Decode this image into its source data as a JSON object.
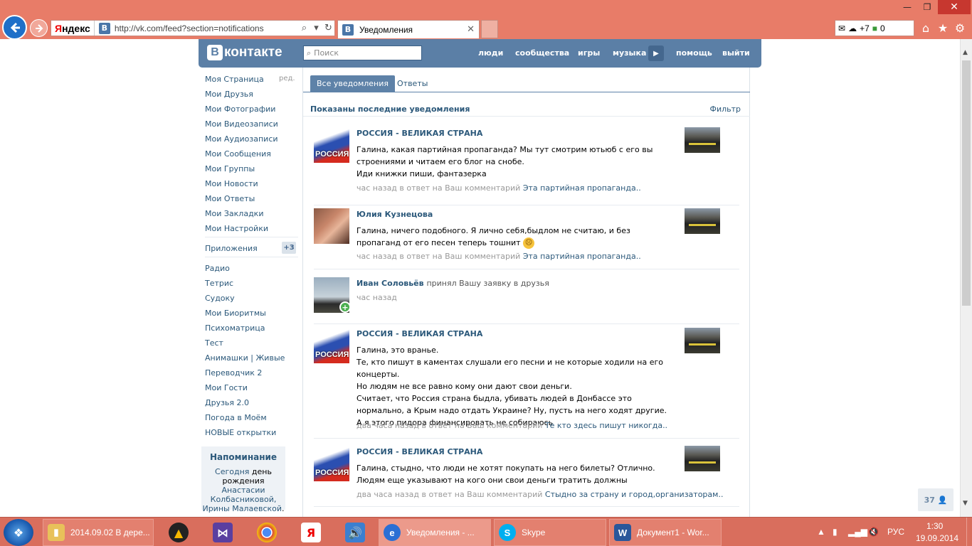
{
  "browser": {
    "yandex_label_y": "Я",
    "yandex_label_rest": "ндекс",
    "url": "http://vk.com/feed?section=notifications",
    "tab_title": "Уведомления",
    "ext_badge_weather": "+7",
    "ext_badge_count": "0"
  },
  "vk_header": {
    "logo_b": "В",
    "logo_text": "контакте",
    "search_placeholder": "Поиск",
    "nav": [
      "люди",
      "сообщества",
      "игры",
      "музыка",
      "помощь",
      "выйти"
    ]
  },
  "left_menu": {
    "edit_label": "ред.",
    "main_items": [
      "Моя Страница",
      "Мои Друзья",
      "Мои Фотографии",
      "Мои Видеозаписи",
      "Мои Аудиозаписи",
      "Мои Сообщения",
      "Мои Группы",
      "Мои Новости",
      "Мои Ответы",
      "Мои Закладки",
      "Мои Настройки"
    ],
    "apps_label": "Приложения",
    "apps_badge": "+3",
    "app_items": [
      "Радио",
      "Тетрис",
      "Судоку",
      "Мои Биоритмы",
      "Психоматрица",
      "Тест",
      "Анимашки | Живые",
      "Переводчик 2",
      "Мои Гости",
      "Друзья 2.0",
      "Погода в Моём",
      "НОВЫЕ открытки"
    ]
  },
  "reminder": {
    "title": "Напоминание",
    "today": "Сегодня",
    "text1": "день",
    "text2": "рождения",
    "names_link": "Анастасии Колбасниковой, Ирины Малаевской",
    "period": "."
  },
  "content": {
    "tabs": [
      "Все уведомления",
      "Ответы"
    ],
    "summary": "Показаны последние уведомления",
    "filter": "Фильтр",
    "notifications": [
      {
        "author": "РОССИЯ - ВЕЛИКАЯ СТРАНА",
        "avatar_text": "РОССИЯ",
        "lines": [
          "Галина, какая партийная пропаганда? Мы тут смотрим ютьюб с его вы строениями и читаем его блог на снобе.",
          "Иди книжки пиши, фантазерка"
        ],
        "meta": "час назад в ответ на Ваш комментарий",
        "meta_link": "Эта партийная пропаганда.."
      },
      {
        "author": "Юлия Кузнецова",
        "lines": [
          "Галина, ничего подобного. Я лично себя,быдлом не считаю, и без пропаганд от его песен теперь тошнит"
        ],
        "meta": "час назад в ответ на Ваш комментарий",
        "meta_link": "Эта партийная пропаганда.."
      },
      {
        "author": "Иван Соловьёв",
        "action": "принял Вашу заявку в друзья",
        "meta": "час назад"
      },
      {
        "author": "РОССИЯ - ВЕЛИКАЯ СТРАНА",
        "avatar_text": "РОССИЯ",
        "lines": [
          "Галина, это вранье.",
          "Те, кто пишут в каментах слушали его песни и не которые ходили на его концерты.",
          "Но людям не все равно кому они дают свои деньги.",
          "Считает, что Россия страна быдла, убивать людей в Донбассе это нормально, а Крым надо отдать Украине? Ну, пусть на него ходят другие.",
          "А я этого пидора финансировать не собираюсь"
        ],
        "meta": "два часа назад в ответ на Ваш комментарий",
        "meta_link": "Те кто здесь пишут никогда.."
      },
      {
        "author": "РОССИЯ - ВЕЛИКАЯ СТРАНА",
        "avatar_text": "РОССИЯ",
        "lines": [
          "Галина, стыдно, что люди не хотят покупать на него билеты? Отлично.",
          "Людям еще указывают на кого они свои деньги тратить должны"
        ],
        "meta": "два часа назад в ответ на Ваш комментарий",
        "meta_link": "Стыдно за страну и город,организаторам.."
      }
    ]
  },
  "online_counter": "37",
  "taskbar": {
    "folder_label": "2014.09.02 В дере...",
    "ie_label": "Уведомления - ...",
    "skype_label": "Skype",
    "word_label": "Документ1 - Wor...",
    "yandex_pin": "Я",
    "lang": "РУС",
    "time": "1:30",
    "date": "19.09.2014"
  }
}
